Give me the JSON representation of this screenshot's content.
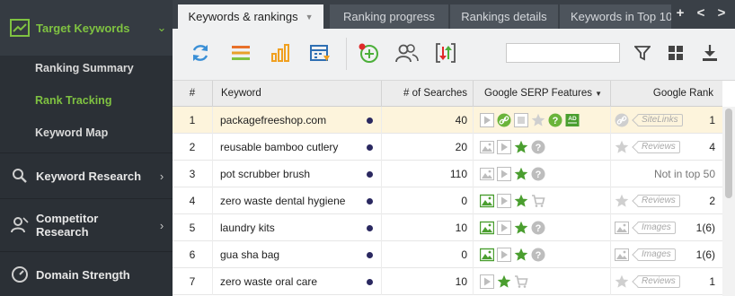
{
  "sidebar": {
    "active_section": "Target Keywords",
    "sub_items": [
      "Ranking Summary",
      "Rank Tracking",
      "Keyword Map"
    ],
    "active_sub": "Rank Tracking",
    "sections": [
      "Keyword Research",
      "Competitor Research",
      "Domain Strength"
    ],
    "accent_color": "#7fc241"
  },
  "tabs": [
    "Keywords & rankings",
    "Ranking progress",
    "Rankings details",
    "Keywords in Top 10"
  ],
  "tab_controls": [
    "+",
    "<",
    ">"
  ],
  "toolbar": {
    "icons": [
      "refresh-icon",
      "list-icon",
      "bar-chart-icon",
      "calendar-icon",
      "add-keyword-icon",
      "users-icon",
      "sort-icon"
    ],
    "search_value": "",
    "right_icons": [
      "filter-icon",
      "grid-icon",
      "download-icon"
    ]
  },
  "table": {
    "headers": {
      "num": "#",
      "keyword": "Keyword",
      "searches": "# of Searches",
      "features": "Google SERP Features",
      "rank": "Google Rank"
    },
    "rows": [
      {
        "num": "1",
        "keyword": "packagefreeshop.com",
        "searches": "40",
        "features": [
          "video",
          "link",
          "gallery",
          "star",
          "question",
          "ad"
        ],
        "badge_icon": "link",
        "badge": "SiteLinks",
        "rank": "1",
        "selected": true
      },
      {
        "num": "2",
        "keyword": "reusable bamboo cutlery",
        "searches": "20",
        "features": [
          "image",
          "video",
          "star",
          "question"
        ],
        "badge_icon": "star",
        "badge": "Reviews",
        "rank": "4",
        "selected": false
      },
      {
        "num": "3",
        "keyword": "pot scrubber brush",
        "searches": "110",
        "features": [
          "image",
          "video",
          "star",
          "question"
        ],
        "badge_icon": "",
        "badge": "",
        "rank": "Not in top 50",
        "selected": false
      },
      {
        "num": "4",
        "keyword": "zero waste dental hygiene",
        "searches": "0",
        "features": [
          "image-green",
          "video",
          "star",
          "cart"
        ],
        "badge_icon": "star",
        "badge": "Reviews",
        "rank": "2",
        "selected": false
      },
      {
        "num": "5",
        "keyword": "laundry kits",
        "searches": "10",
        "features": [
          "image-green",
          "video",
          "star",
          "question"
        ],
        "badge_icon": "image",
        "badge": "Images",
        "rank": "1(6)",
        "selected": false
      },
      {
        "num": "6",
        "keyword": "gua sha bag",
        "searches": "0",
        "features": [
          "image-green",
          "video",
          "star",
          "question"
        ],
        "badge_icon": "image",
        "badge": "Images",
        "rank": "1(6)",
        "selected": false
      },
      {
        "num": "7",
        "keyword": "zero waste oral care",
        "searches": "10",
        "features": [
          "video",
          "star",
          "cart"
        ],
        "badge_icon": "star",
        "badge": "Reviews",
        "rank": "1",
        "selected": false
      }
    ]
  }
}
